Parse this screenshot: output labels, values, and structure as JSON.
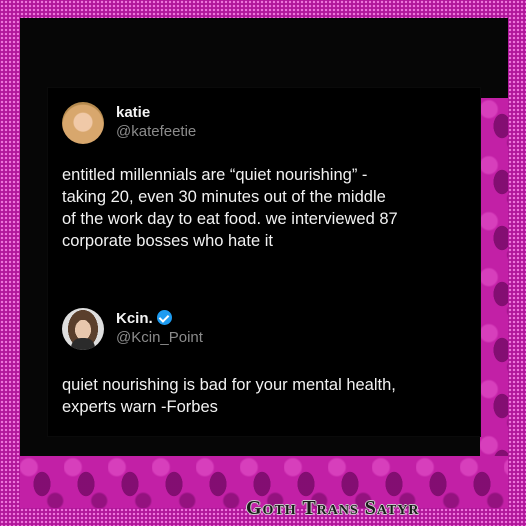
{
  "colors": {
    "frame_pink": "#b0169a",
    "damask_magenta": "#c220a6",
    "background": "#060606",
    "text_primary": "#f2f2f2",
    "text_secondary": "#8b8b8b",
    "verified_blue": "#1d9bf0"
  },
  "tweets": [
    {
      "display_name": "katie",
      "handle": "@katefeetie",
      "verified": false,
      "avatar_icon": "avatar-photo-woman",
      "lines": [
        "entitled millennials are “quiet nourishing” -",
        "taking 20, even 30 minutes out of the middle",
        "of the work day to eat food. we interviewed 87",
        "corporate bosses who hate it"
      ]
    },
    {
      "display_name": "Kcin.",
      "handle": "@Kcin_Point",
      "verified": true,
      "avatar_icon": "avatar-photo-man",
      "lines": [
        "quiet nourishing is bad for your mental health,",
        "experts warn -Forbes"
      ]
    }
  ],
  "watermark": "Goth Trans Satyr"
}
